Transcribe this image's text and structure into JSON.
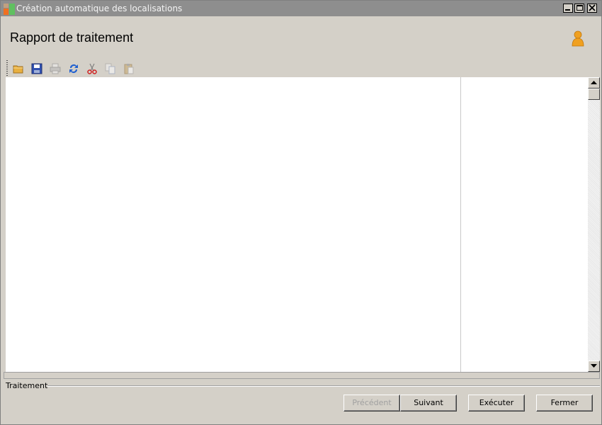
{
  "window": {
    "title": "Création automatique des localisations"
  },
  "header": {
    "title": "Rapport de traitement",
    "user_icon": "user-icon"
  },
  "toolbar": {
    "items": [
      {
        "name": "open-folder-icon",
        "enabled": true
      },
      {
        "name": "save-icon",
        "enabled": true
      },
      {
        "name": "print-icon",
        "enabled": false
      },
      {
        "name": "refresh-icon",
        "enabled": true
      },
      {
        "name": "cut-icon",
        "enabled": true
      },
      {
        "name": "copy-icon",
        "enabled": false
      },
      {
        "name": "paste-icon",
        "enabled": false
      }
    ]
  },
  "group": {
    "label": "Traitement"
  },
  "buttons": {
    "previous": "Précédent",
    "next": "Suivant",
    "execute": "Exécuter",
    "close": "Fermer"
  },
  "colors": {
    "titlebar": "#8e8e8e",
    "background": "#d4d0c8",
    "content": "#ffffff"
  }
}
